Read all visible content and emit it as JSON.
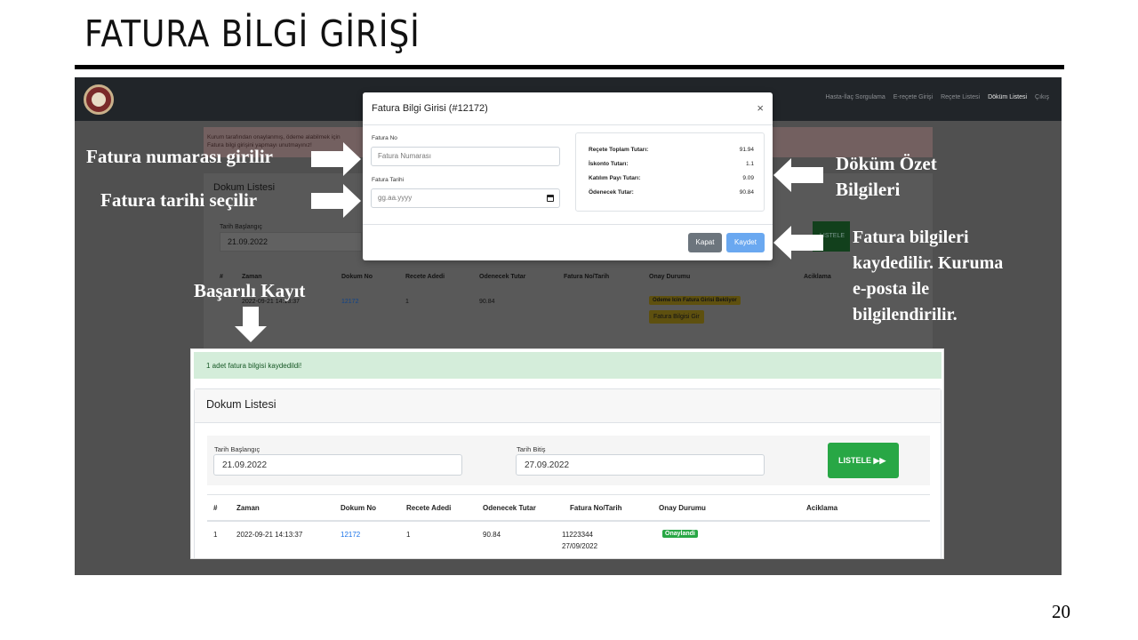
{
  "slide": {
    "title": "FATURA BİLGİ GİRİŞİ",
    "page_number": "20"
  },
  "app": {
    "nav": [
      "Hasta-İlaç Sorgulama",
      "E-reçete Girişi",
      "Reçete Listesi",
      "Döküm Listesi",
      "Çıkış"
    ],
    "active_nav": "Döküm Listesi",
    "bg_alert_line1": "Kurum tarafından onaylanmış, ödeme alabilmek için",
    "bg_alert_line2": "Fatura bilgi girişini yapmayı unutmayınız!",
    "bg_card_title": "Dokum Listesi",
    "bg_date_label": "Tarih Başlangıç",
    "bg_date_value": "21.09.2022",
    "bg_listele": "LISTELE",
    "bg_table_headers": [
      "#",
      "Zaman",
      "Dokum No",
      "Recete Adedi",
      "Odenecek Tutar",
      "Fatura No/Tarih",
      "Onay Durumu",
      "Aciklama"
    ],
    "bg_row": {
      "zaman": "2022-09-21 14:13:37",
      "dokum_no": "12172",
      "recete": "1",
      "tutar": "90.84"
    },
    "bg_badge": "Odeme Icin Fatura Girisi Bekliyor",
    "bg_button": "Fatura Bilgisi Gir"
  },
  "modal": {
    "title": "Fatura Bilgi Girisi (#12172)",
    "close": "×",
    "fatura_no_label": "Fatura No",
    "fatura_no_placeholder": "Fatura Numarası",
    "fatura_tarihi_label": "Fatura Tarihi",
    "fatura_tarihi_placeholder": "gg.aa.yyyy",
    "summary": [
      {
        "label": "Reçete Toplam Tutarı:",
        "value": "91.94"
      },
      {
        "label": "İskonto Tutarı:",
        "value": "1.1"
      },
      {
        "label": "Katılım Payı Tutarı:",
        "value": "9.09"
      },
      {
        "label": "Ödenecek Tutar:",
        "value": "90.84"
      }
    ],
    "kapat": "Kapat",
    "kaydet": "Kaydet"
  },
  "annotations": {
    "fatura_no": "Fatura numarası girilir",
    "fatura_tarihi": "Fatura tarihi seçilir",
    "ozet_line1": "Döküm Özet",
    "ozet_line2": "Bilgileri",
    "kaydet_lines": [
      "Fatura bilgileri",
      "kaydedilir. Kuruma",
      "e-posta ile",
      "bilgilendirilir."
    ],
    "basarili": "Başarılı Kayıt"
  },
  "result": {
    "alert": "1 adet fatura bilgisi kaydedildi!",
    "card_title": "Dokum Listesi",
    "start_label": "Tarih Başlangıç",
    "start_value": "21.09.2022",
    "end_label": "Tarih Bitiş",
    "end_value": "27.09.2022",
    "listele": "LISTELE ▶▶",
    "headers": [
      "#",
      "Zaman",
      "Dokum No",
      "Recete Adedi",
      "Odenecek Tutar",
      "Fatura No/Tarih",
      "Onay Durumu",
      "Aciklama"
    ],
    "row": {
      "num": "1",
      "zaman": "2022-09-21 14:13:37",
      "dokum_no": "12172",
      "recete": "1",
      "tutar": "90.84",
      "fatura_no": "11223344",
      "fatura_tarih": "27/09/2022",
      "durum": "Onaylandi"
    }
  }
}
